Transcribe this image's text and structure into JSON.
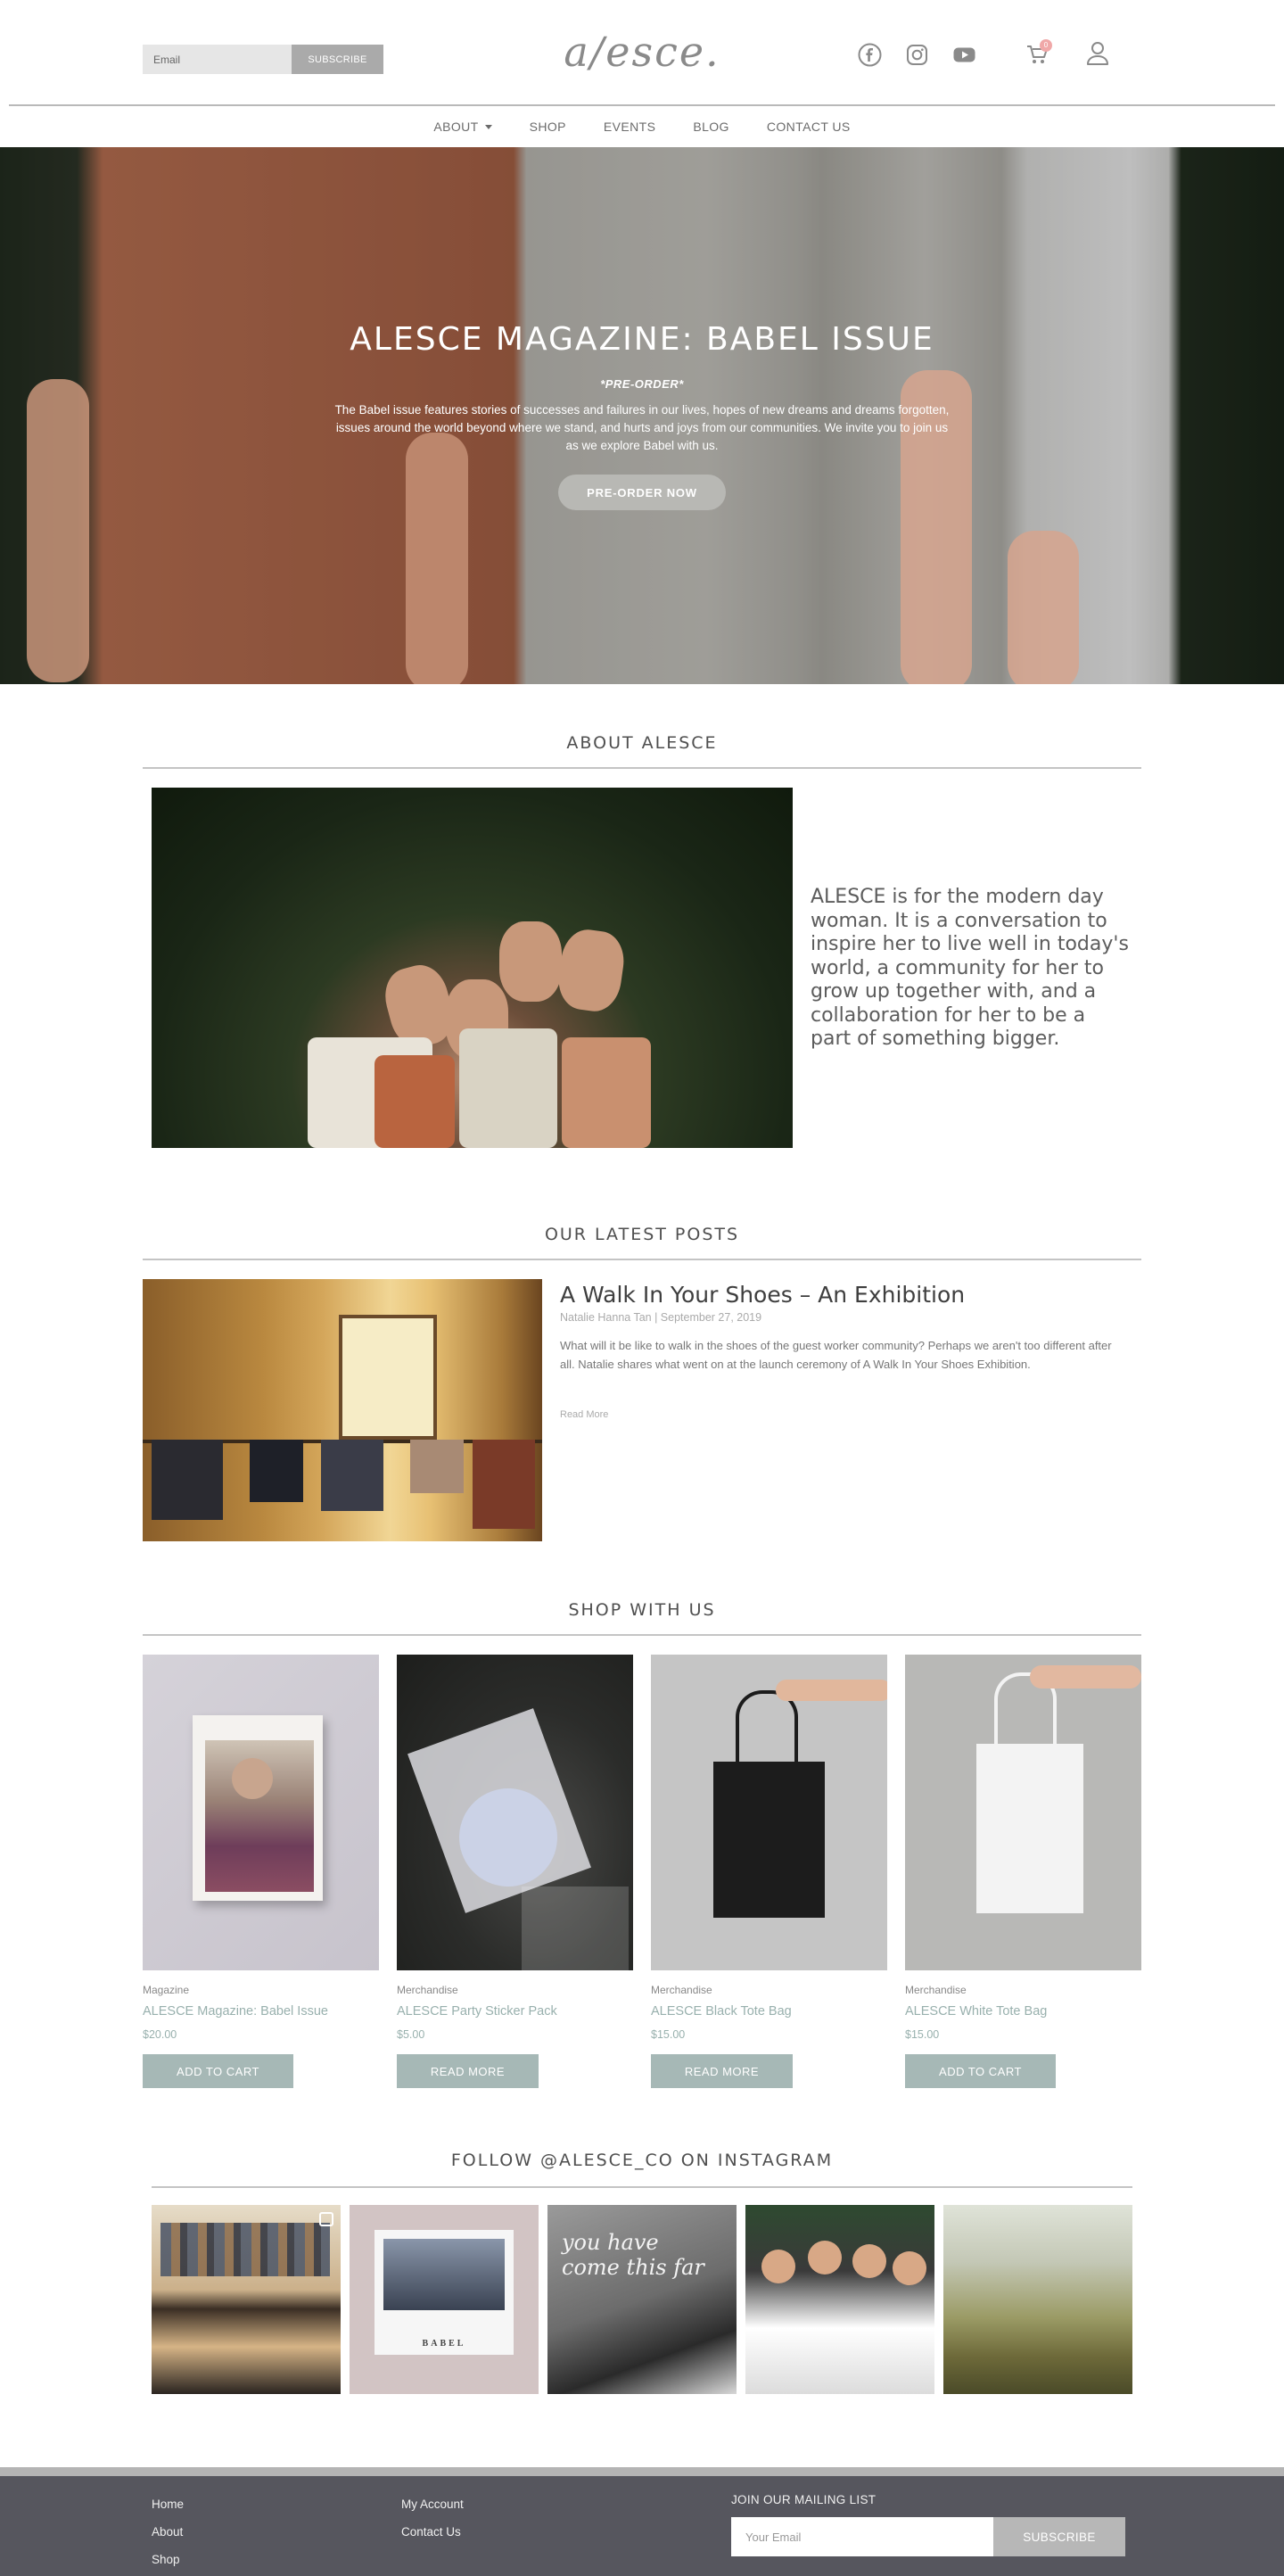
{
  "header": {
    "email_placeholder": "Email",
    "subscribe_label": "SUBSCRIBE",
    "logo_text": "a/esce.",
    "social_icons": [
      "facebook-icon",
      "instagram-icon",
      "youtube-icon"
    ],
    "cart_icon": "cart-icon",
    "cart_count": "0",
    "account_icon": "user-icon"
  },
  "nav": {
    "items": [
      {
        "label": "ABOUT",
        "has_dropdown": true
      },
      {
        "label": "SHOP"
      },
      {
        "label": "EVENTS"
      },
      {
        "label": "BLOG"
      },
      {
        "label": "CONTACT US"
      }
    ]
  },
  "hero": {
    "title": "ALESCE MAGAZINE: BABEL ISSUE",
    "preorder_tag": "*PRE-ORDER*",
    "description": "The Babel issue features stories of successes and failures in our lives, hopes of new dreams and dreams forgotten, issues around the world beyond where we stand, and hurts and joys from our communities. We invite you to join us as we explore Babel with us.",
    "button_label": "PRE-ORDER NOW"
  },
  "about": {
    "title": "ABOUT ALESCE",
    "text": "ALESCE is for the modern day woman. It is a conversation to inspire her to live well in today's world, a community for her to grow up together with, and a collaboration for her to be a part of something bigger."
  },
  "posts": {
    "title": "OUR LATEST POSTS",
    "items": [
      {
        "title": "A Walk In Your Shoes – An Exhibition",
        "meta": "Natalie Hanna Tan | September 27, 2019",
        "excerpt": "What will it be like to walk in the shoes of the guest worker community? Perhaps we aren't too different after all. Natalie shares what went on at the launch ceremony of A Walk In Your Shoes Exhibition.",
        "read_more": "Read More"
      }
    ]
  },
  "shop": {
    "title": "SHOP WITH US",
    "products": [
      {
        "category": "Magazine",
        "name": "ALESCE Magazine: Babel Issue",
        "price": "$20.00",
        "button": "ADD TO CART"
      },
      {
        "category": "Merchandise",
        "name": "ALESCE Party Sticker Pack",
        "price": "$5.00",
        "button": "READ MORE"
      },
      {
        "category": "Merchandise",
        "name": "ALESCE Black Tote Bag",
        "price": "$15.00",
        "button": "READ MORE"
      },
      {
        "category": "Merchandise",
        "name": "ALESCE White Tote Bag",
        "price": "$15.00",
        "button": "ADD TO CART"
      }
    ]
  },
  "instagram": {
    "title": "FOLLOW @ALESCE_CO ON INSTAGRAM",
    "tiles": [
      {
        "overlay_text": ""
      },
      {
        "overlay_text": "BABEL"
      },
      {
        "overlay_text": "you have come this far"
      },
      {
        "overlay_text": ""
      },
      {
        "overlay_text": ""
      }
    ]
  },
  "footer": {
    "col1": [
      "Home",
      "About",
      "Shop"
    ],
    "col2": [
      "My Account",
      "Contact Us"
    ],
    "mailing_title": "JOIN OUR MAILING LIST",
    "email_placeholder": "Your Email",
    "subscribe_label": "SUBSCRIBE"
  },
  "colors": {
    "accent_teal": "#98b0ad",
    "button_teal": "#a6b8b6",
    "footer_bg": "#56565e",
    "cart_badge": "#f0a8a8"
  }
}
